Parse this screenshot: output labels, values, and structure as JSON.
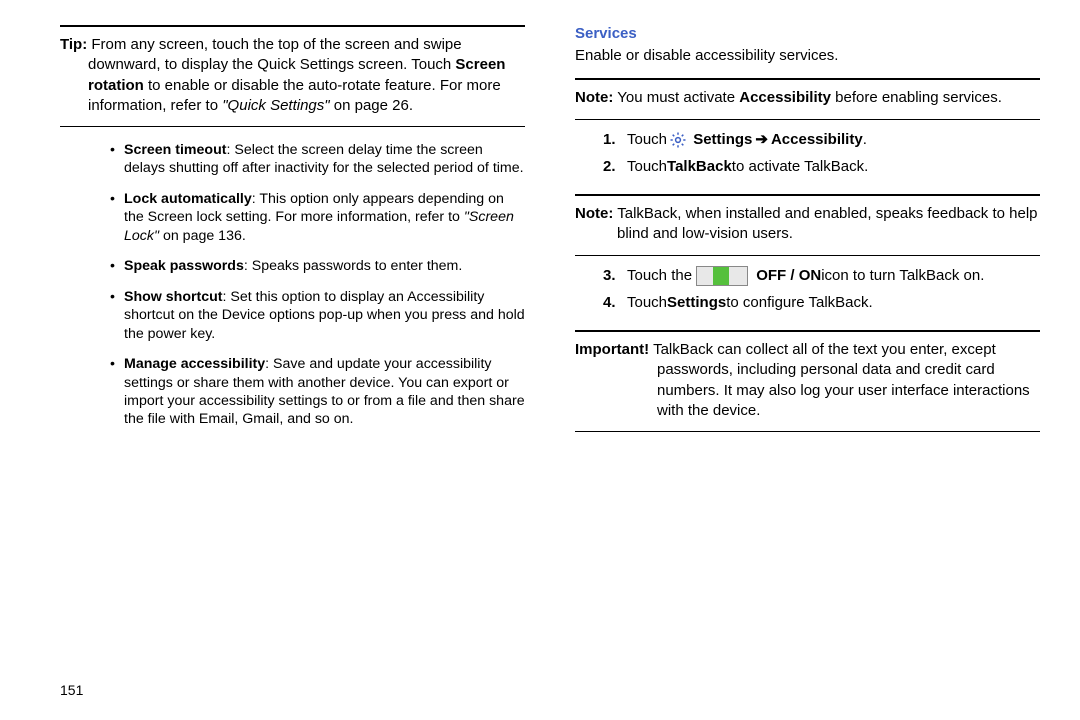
{
  "left": {
    "tip": {
      "label": "Tip:",
      "text1": " From any screen, touch the top of the screen and swipe downward, to display the Quick Settings screen. Touch ",
      "bold1": "Screen rotation",
      "text2": " to enable or disable the auto-rotate feature. For more information, refer to ",
      "italic1": "\"Quick Settings\"",
      "text3": " on page 26."
    },
    "bullets": [
      {
        "bold": "Screen timeout",
        "text": ": Select the screen delay time the screen delays shutting off after inactivity for the selected period of time."
      },
      {
        "bold": "Lock automatically",
        "text": ": This option only appears depending on the Screen lock setting. For more information, refer to ",
        "italic": "\"Screen Lock\"",
        "tail": " on page 136."
      },
      {
        "bold": "Speak passwords",
        "text": ": Speaks passwords to enter them."
      },
      {
        "bold": "Show shortcut",
        "text": ": Set this option to display an Accessibility shortcut on the Device options pop-up when you press and hold the power key."
      },
      {
        "bold": "Manage accessibility",
        "text": ": Save and update your accessibility settings or share them with another device. You can export or import your accessibility settings to or from a file and then share the file with Email, Gmail, and so on."
      }
    ]
  },
  "right": {
    "section_title": "Services",
    "intro": "Enable or disable accessibility services.",
    "note1": {
      "label": "Note:",
      "text": " You must activate ",
      "bold": "Accessibility",
      "tail": " before enabling services."
    },
    "step1": {
      "pre": "Touch ",
      "b1": "Settings",
      "b2": "Accessibility"
    },
    "step2": {
      "pre": "Touch ",
      "b1": "TalkBack",
      "tail": " to activate TalkBack."
    },
    "note2": {
      "label": "Note:",
      "text": " TalkBack, when installed and enabled, speaks feedback to help blind and low-vision users."
    },
    "step3": {
      "pre": "Touch the ",
      "b1": "OFF / ON",
      "tail": " icon to turn TalkBack on."
    },
    "step4": {
      "pre": "Touch ",
      "b1": "Settings",
      "tail": " to configure TalkBack."
    },
    "important": {
      "label": "Important!",
      "text": " TalkBack can collect all of the text you enter, except passwords, including personal data and credit card numbers. It may also log your user interface interactions with the device."
    }
  },
  "page_number": "151"
}
